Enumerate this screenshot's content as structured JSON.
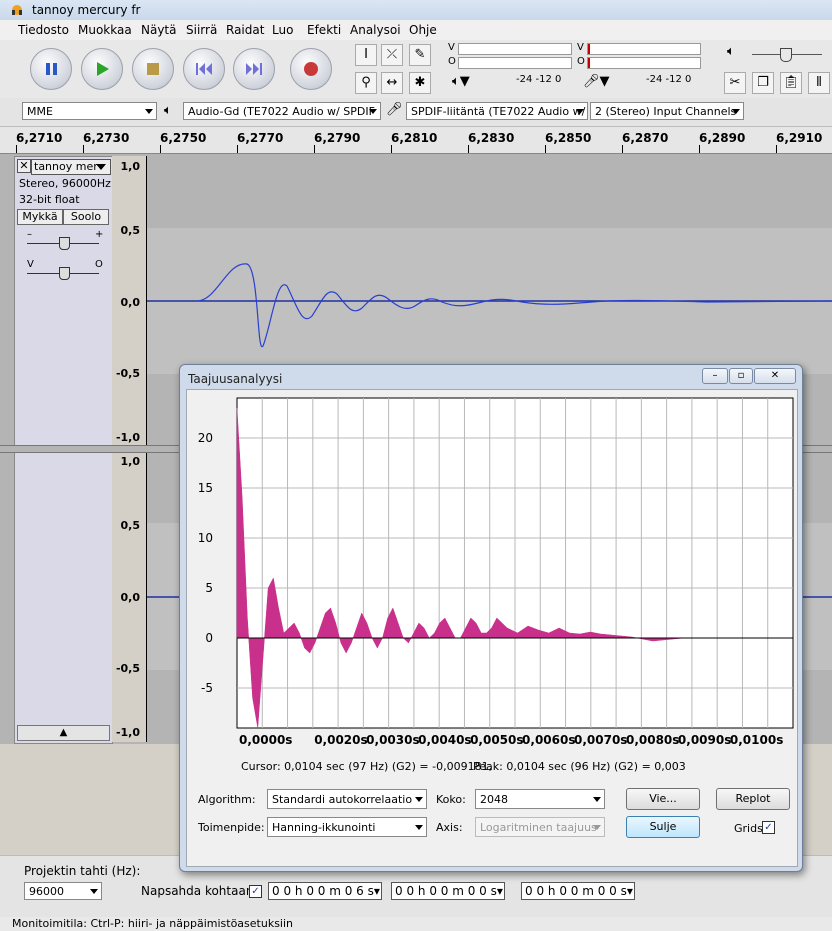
{
  "window": {
    "title": "tannoy mercury fr"
  },
  "menu": [
    "Tiedosto",
    "Muokkaa",
    "Näytä",
    "Siirrä",
    "Raidat",
    "Luo",
    "Efekti",
    "Analysoi",
    "Ohje"
  ],
  "meters": {
    "play_v": "V",
    "play_o": "O",
    "rec_v": "V",
    "rec_o": "O",
    "play_scale": "-24  -12  0",
    "rec_scale": "-24  -12  0"
  },
  "devices": {
    "host": "MME",
    "output": "Audio-Gd (TE7022 Audio w/ SPDIF",
    "input": "SPDIF-liitäntä (TE7022 Audio w/",
    "channels": "2 (Stereo) Input Channels"
  },
  "ruler": [
    "6,2710",
    "6,2730",
    "6,2750",
    "6,2770",
    "6,2790",
    "6,2810",
    "6,2830",
    "6,2850",
    "6,2870",
    "6,2890",
    "6,2910"
  ],
  "track": {
    "name": "tannoy mer",
    "info1": "Stereo, 96000Hz",
    "info2": "32-bit float",
    "mute": "Mykkä",
    "solo": "Soolo",
    "gain_minus": "–",
    "gain_plus": "+",
    "pan_left": "V",
    "pan_right": "O",
    "scale_top": [
      "1,0",
      "0,5",
      "0,0",
      "-0,5",
      "-1,0"
    ],
    "scale_bottom": [
      "1,0",
      "0,5",
      "0,0",
      "-0,5",
      "-1,0"
    ]
  },
  "bottom": {
    "rate_label": "Projektin tahti (Hz):",
    "rate_value": "96000",
    "snap_label": "Napsahda kohtaan",
    "time1": "0 0 h 0 0 m 0 6 s",
    "time2": "0 0 h 0 0 m 0 0 s",
    "time3": "0 0 h 0 0 m 0 0 s"
  },
  "status": "Monitoimitila: Ctrl-P: hiiri- ja näppäimistöasetuksiin",
  "dialog": {
    "title": "Taajuusanalyysi",
    "cursor_text": "Cursor: 0,0104 sec (97 Hz) (G2) = -0,009181,",
    "peak_text": "Peak: 0,0104 sec (96 Hz) (G2) = 0,003",
    "algorithm_label": "Algorithm:",
    "algorithm_value": "Standardi autokorrelaatio",
    "size_label": "Koko:",
    "size_value": "2048",
    "function_label": "Toimenpide:",
    "function_value": "Hanning-ikkunointi",
    "axis_label": "Axis:",
    "axis_value": "Logaritminen taajuus",
    "export_btn": "Vie...",
    "replot_btn": "Replot",
    "close_btn": "Sulje",
    "grids_label": "Grids"
  },
  "chart_data": {
    "type": "area",
    "title": "",
    "xlabel": "",
    "ylabel": "",
    "xlim": [
      0,
      0.0107
    ],
    "ylim": [
      -9,
      24
    ],
    "yticks": [
      20,
      15,
      10,
      5,
      0,
      -5
    ],
    "xticks": [
      "0,0000s",
      "0,0020s",
      "0,0030s",
      "0,0040s",
      "0,0050s",
      "0,0060s",
      "0,0070s",
      "0,0080s",
      "0,0090s",
      "0,0100s"
    ],
    "xtick_values": [
      0,
      0.002,
      0.003,
      0.004,
      0.005,
      0.006,
      0.007,
      0.008,
      0.009,
      0.01
    ],
    "grid": true,
    "color": "#c8308c",
    "x": [
      0,
      0.0001,
      0.0002,
      0.0003,
      0.0004,
      0.0005,
      0.0006,
      0.0007,
      0.0008,
      0.0009,
      0.001,
      0.0011,
      0.0012,
      0.0013,
      0.0014,
      0.0015,
      0.0016,
      0.0017,
      0.0018,
      0.0019,
      0.002,
      0.0021,
      0.0022,
      0.0023,
      0.0024,
      0.0025,
      0.0026,
      0.0027,
      0.0028,
      0.0029,
      0.003,
      0.0031,
      0.0032,
      0.0033,
      0.0034,
      0.0035,
      0.0036,
      0.0037,
      0.0038,
      0.0039,
      0.004,
      0.0041,
      0.0042,
      0.0043,
      0.0044,
      0.0045,
      0.0046,
      0.0047,
      0.0048,
      0.0049,
      0.005,
      0.0052,
      0.0054,
      0.0056,
      0.0058,
      0.006,
      0.0062,
      0.0064,
      0.0066,
      0.0068,
      0.007,
      0.0072,
      0.0074,
      0.0076,
      0.0078,
      0.008,
      0.0082,
      0.0084,
      0.0086,
      0.0088,
      0.009,
      0.0092,
      0.0094,
      0.0096,
      0.0098,
      0.01,
      0.0102,
      0.0104,
      0.0106
    ],
    "y": [
      23,
      14,
      2,
      -6,
      -9,
      -2,
      5,
      6,
      3,
      0.5,
      1,
      1.5,
      0.5,
      -1,
      -1.5,
      -0.5,
      1,
      2.5,
      3,
      1.5,
      -0.5,
      -1.5,
      -0.5,
      1,
      2.5,
      1.5,
      0,
      -1,
      0,
      2,
      3,
      1.5,
      0,
      -0.5,
      0.5,
      1.5,
      1,
      0,
      0.5,
      1.5,
      2,
      1,
      0,
      0,
      1,
      2,
      1.5,
      0.5,
      0.5,
      1,
      2,
      1,
      0.5,
      1.2,
      0.8,
      0.5,
      1,
      0.5,
      0.4,
      0.6,
      0.4,
      0.3,
      0.2,
      0.1,
      -0.1,
      -0.3,
      -0.2,
      -0.1,
      0,
      0,
      0,
      0,
      0,
      0,
      0,
      0,
      0,
      0,
      0
    ]
  }
}
